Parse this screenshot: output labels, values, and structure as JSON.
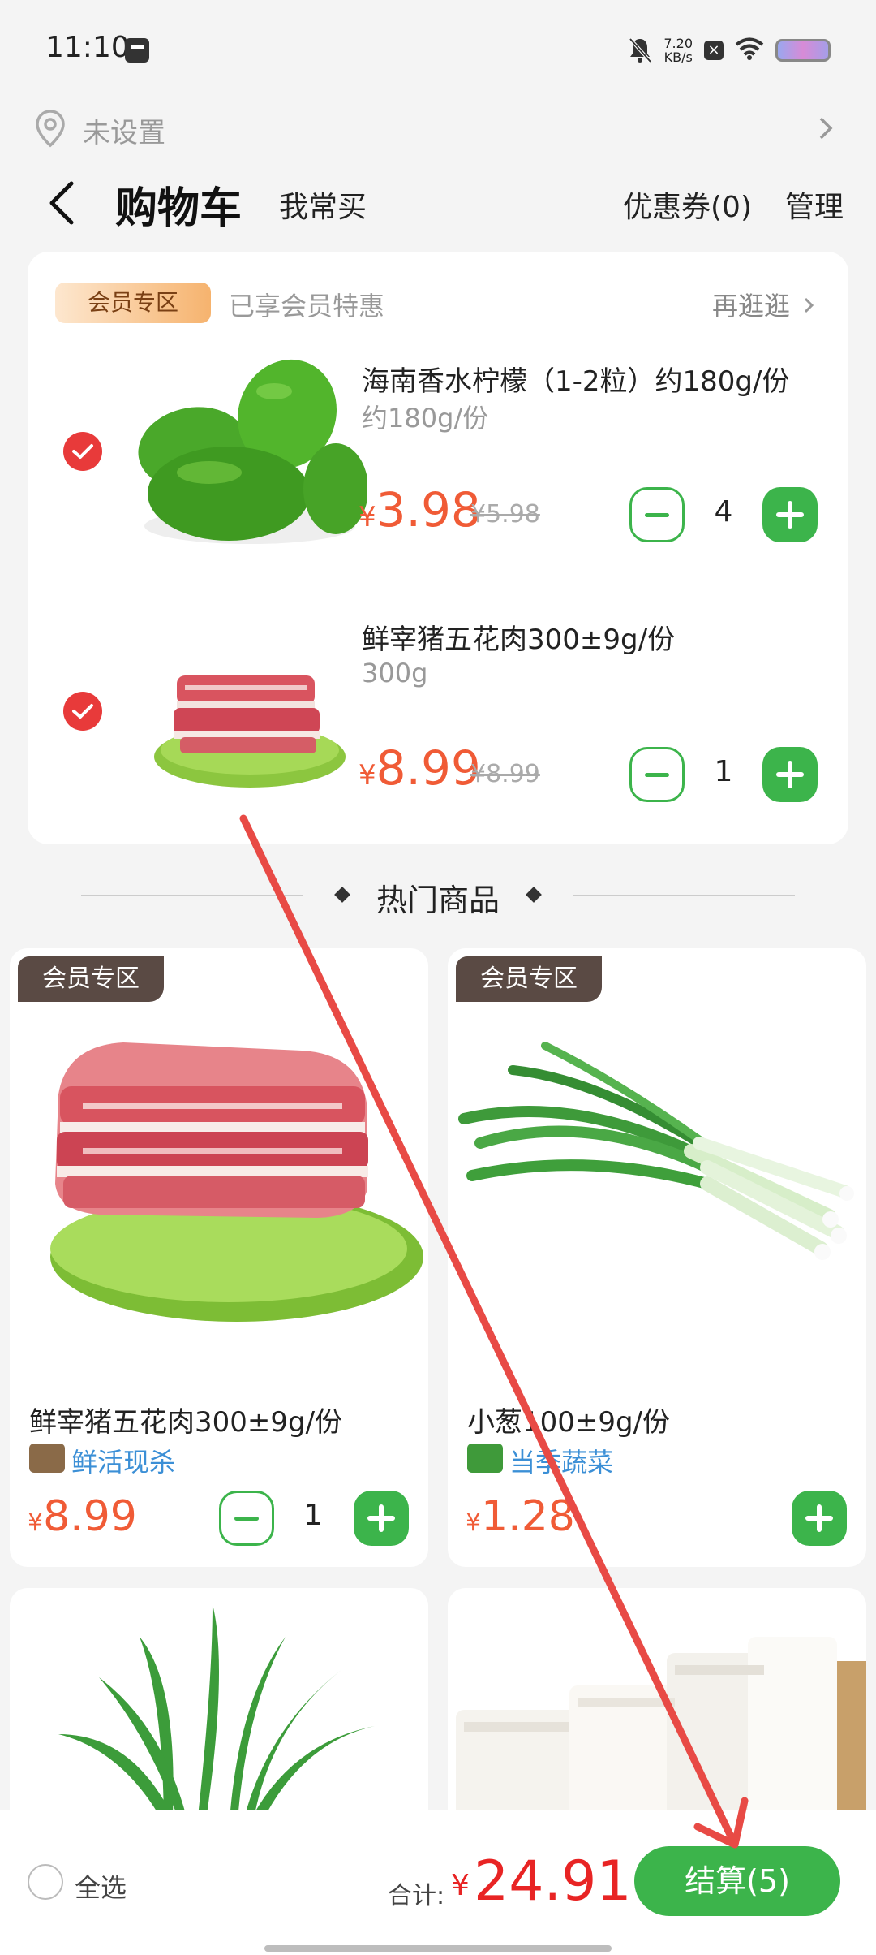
{
  "status_bar": {
    "time": "11:10",
    "net_speed_value": "7.20",
    "net_speed_unit": "KB/s"
  },
  "location": {
    "text": "未设置"
  },
  "header": {
    "title": "购物车",
    "tab_often": "我常买",
    "coupon": "优惠券(0)",
    "manage": "管理"
  },
  "cart": {
    "member_tag": "会员专区",
    "member_hint": "已享会员特惠",
    "browse": "再逛逛",
    "items": [
      {
        "name": "海南香水柠檬（1-2粒）约180g/份",
        "spec": "约180g/份",
        "price_symbol": "¥",
        "price": "3.98",
        "orig_price": "¥5.98",
        "qty": "4",
        "checked": true
      },
      {
        "name": "鲜宰猪五花肉300±9g/份",
        "spec": "300g",
        "price_symbol": "¥",
        "price": "8.99",
        "orig_price": "¥8.99",
        "qty": "1",
        "checked": true
      }
    ]
  },
  "hot": {
    "title": "热门商品",
    "products": [
      {
        "tag": "会员专区",
        "name": "鲜宰猪五花肉300±9g/份",
        "feature": "鲜活现杀",
        "price_symbol": "¥",
        "price": "8.99",
        "qty": "1"
      },
      {
        "tag": "会员专区",
        "name": "小葱100±9g/份",
        "feature": "当季蔬菜",
        "price_symbol": "¥",
        "price": "1.28"
      }
    ]
  },
  "bottom": {
    "select_all": "全选",
    "total_label": "合计:",
    "total_symbol": "¥",
    "total": "24.91",
    "checkout": "结算(5)"
  },
  "colors": {
    "accent_green": "#3cb44b",
    "price_orange": "#f05b36",
    "total_red": "#e82424",
    "check_red": "#e83a3a",
    "annotation_arrow": "#e84a45"
  }
}
